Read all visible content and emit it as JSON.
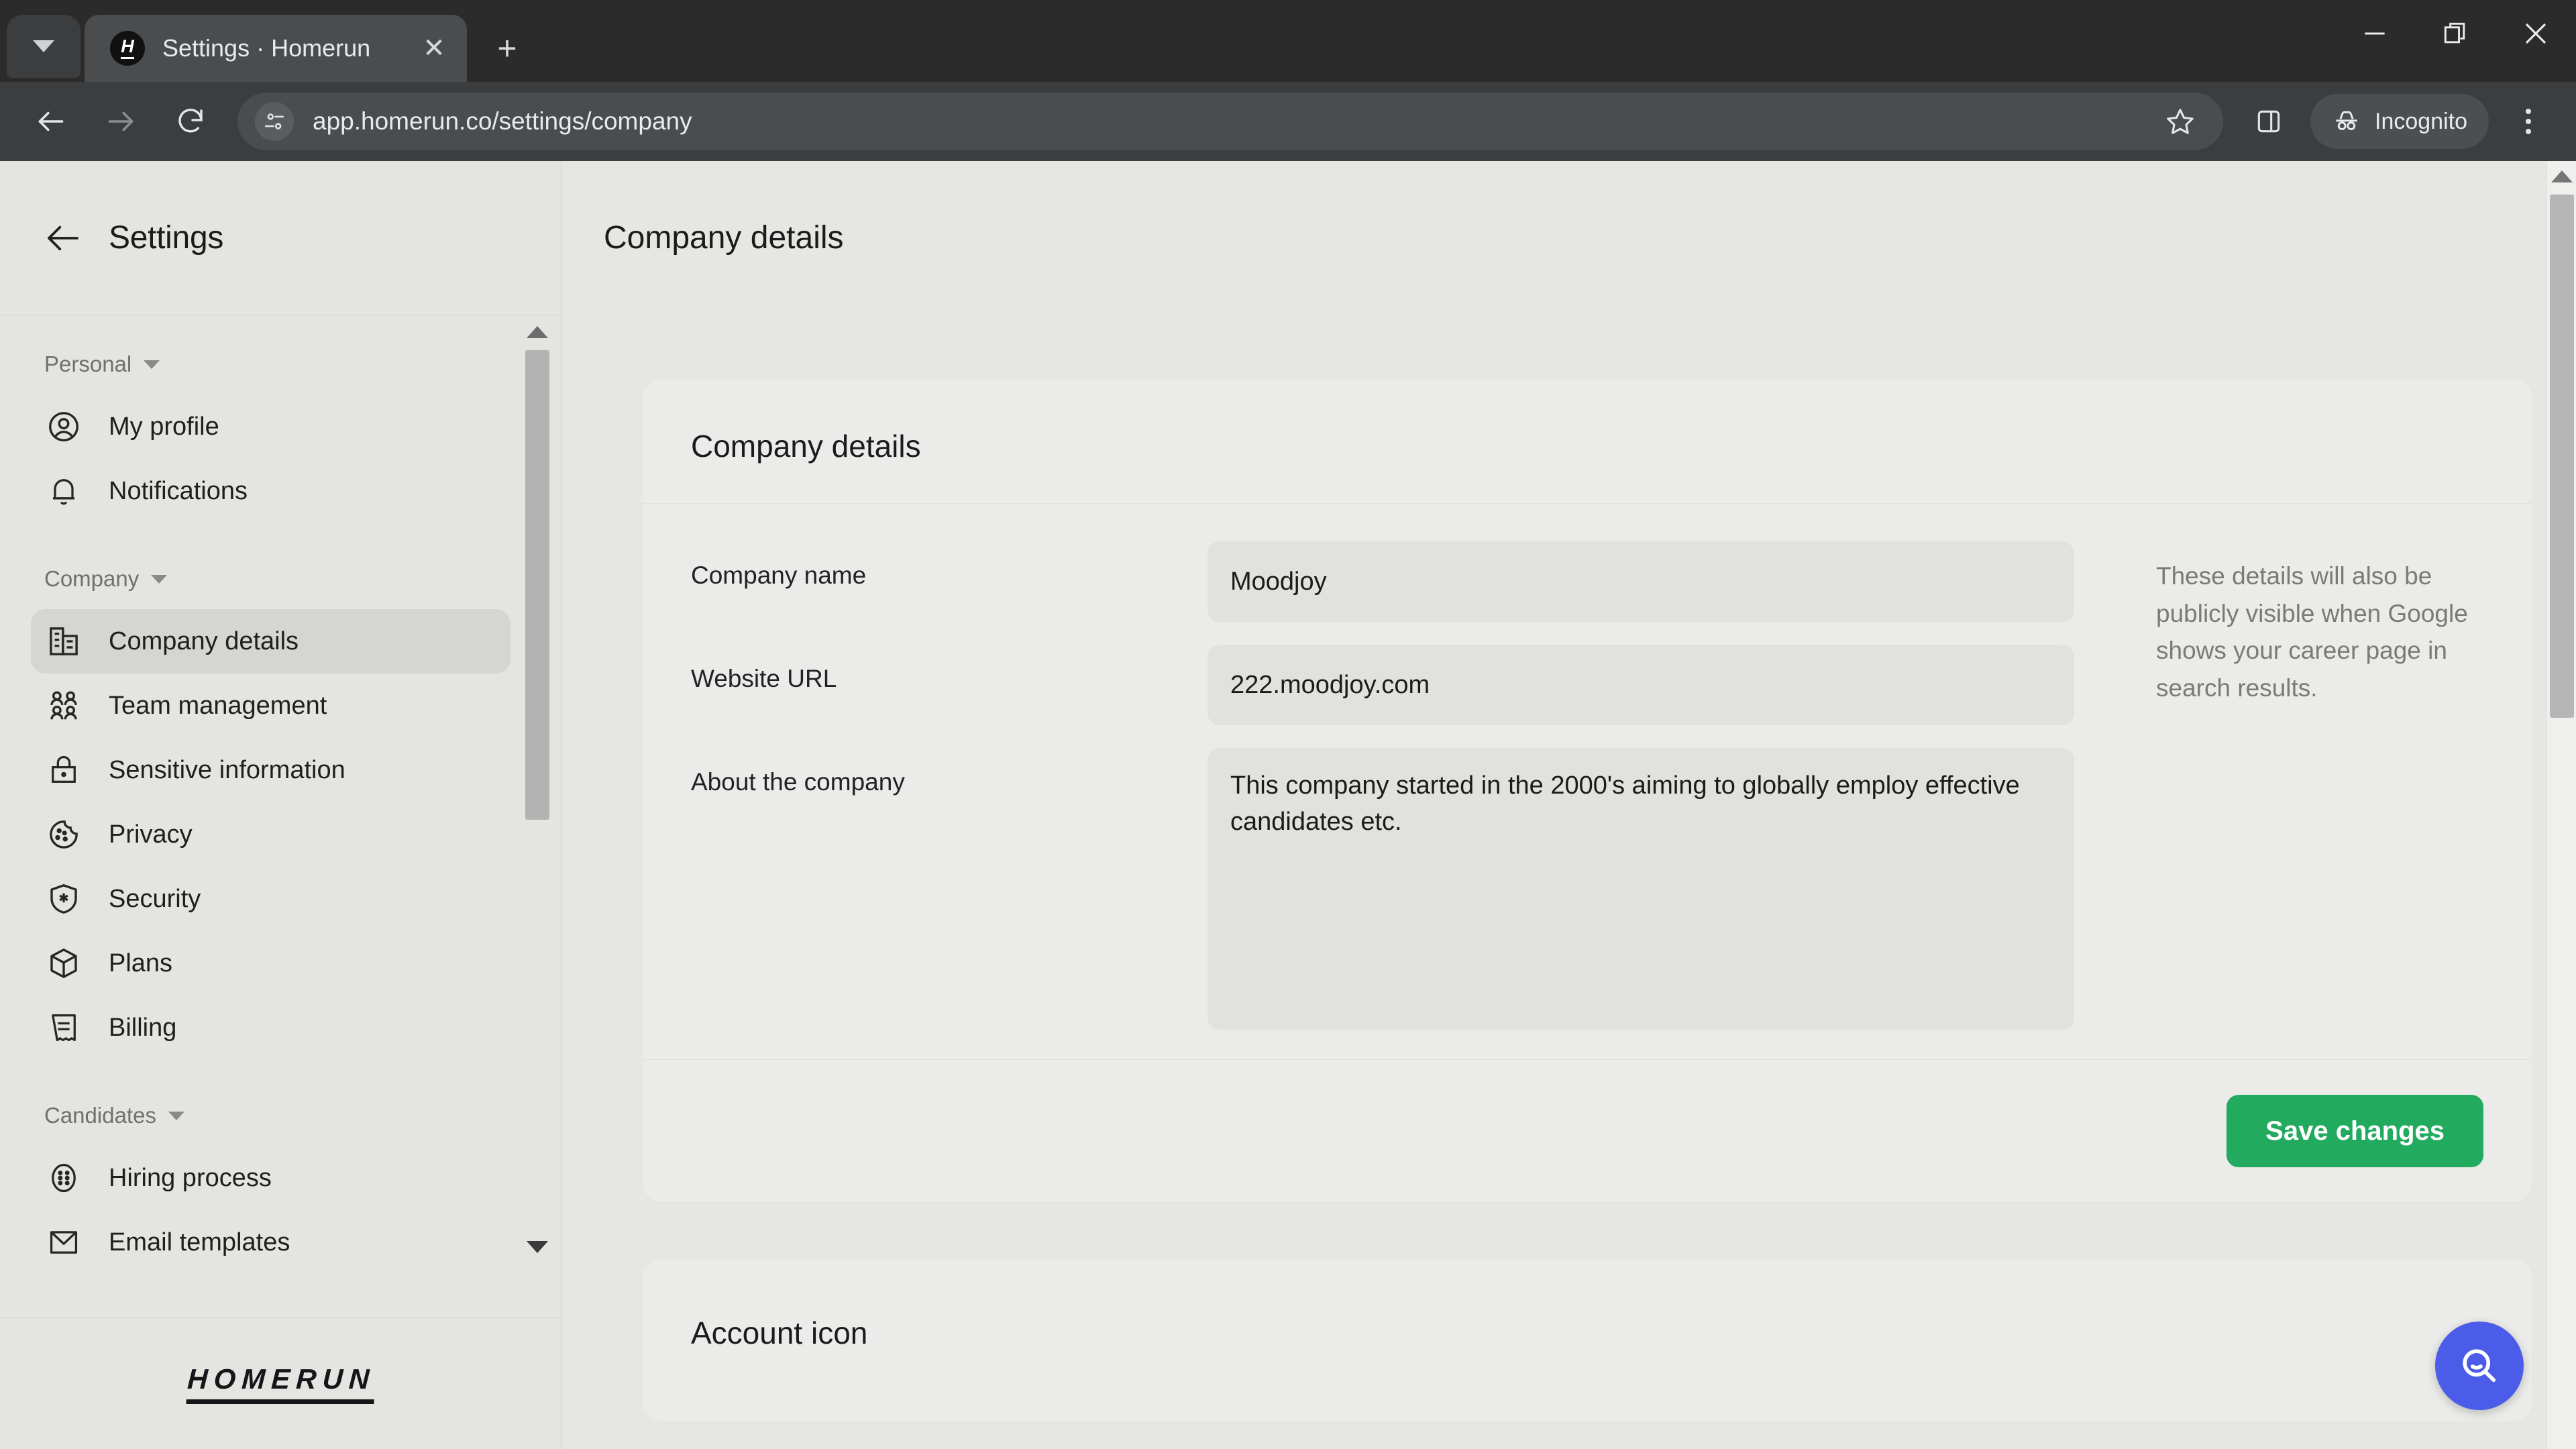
{
  "browser": {
    "tab": {
      "title": "Settings · Homerun",
      "favicon_letter": "H",
      "favicon_name": "homerun-favicon",
      "close_label": "✕"
    },
    "new_tab_label": "+",
    "tab_list_icon": "chevron-down-icon",
    "window": {
      "minimize": "minimize-icon",
      "maximize": "restore-icon",
      "close": "close-icon"
    },
    "nav": {
      "back": "back-arrow-icon",
      "forward": "forward-arrow-icon",
      "reload": "reload-icon"
    },
    "omnibox": {
      "url": "app.homerun.co/settings/company",
      "site_info_icon": "site-settings-icon",
      "bookmark_icon": "star-icon",
      "side_panel_icon": "side-panel-icon"
    },
    "incognito_label": "Incognito",
    "menu_icon": "kebab-menu-icon"
  },
  "sidebar": {
    "back_icon": "left-arrow-icon",
    "title": "Settings",
    "groups": [
      {
        "label": "Personal",
        "items": [
          {
            "label": "My profile",
            "icon": "user-circle-icon",
            "active": false
          },
          {
            "label": "Notifications",
            "icon": "bell-icon",
            "active": false
          }
        ]
      },
      {
        "label": "Company",
        "items": [
          {
            "label": "Company details",
            "icon": "building-icon",
            "active": true
          },
          {
            "label": "Team management",
            "icon": "people-icon",
            "active": false
          },
          {
            "label": "Sensitive information",
            "icon": "lock-icon",
            "active": false
          },
          {
            "label": "Privacy",
            "icon": "cookie-icon",
            "active": false
          },
          {
            "label": "Security",
            "icon": "shield-star-icon",
            "active": false
          },
          {
            "label": "Plans",
            "icon": "box-icon",
            "active": false
          },
          {
            "label": "Billing",
            "icon": "receipt-icon",
            "active": false
          }
        ]
      },
      {
        "label": "Candidates",
        "items": [
          {
            "label": "Hiring process",
            "icon": "process-circle-icon",
            "active": false
          },
          {
            "label": "Email templates",
            "icon": "envelope-icon",
            "active": false
          }
        ]
      }
    ],
    "logo": "HOMERUN"
  },
  "main": {
    "header_title": "Company details",
    "card": {
      "title": "Company details",
      "fields": [
        {
          "label": "Company name",
          "value": "Moodjoy",
          "type": "text"
        },
        {
          "label": "Website URL",
          "value": "222.moodjoy.com",
          "type": "text"
        },
        {
          "label": "About the company",
          "value": "This company started in the 2000's aiming to globally employ effective candidates etc.",
          "type": "textarea"
        }
      ],
      "help_text": "These details will also be publicly visible when Google shows your career page in search results.",
      "save_label": "Save changes"
    },
    "second_card_title": "Account icon",
    "fab_icon": "search-icon"
  },
  "colors": {
    "accent_green": "#22aa5f",
    "fab_blue": "#4a5ce8",
    "page_bg": "#e6e6e3",
    "card_bg": "#ebebe9",
    "input_bg": "#e1e1dd"
  }
}
